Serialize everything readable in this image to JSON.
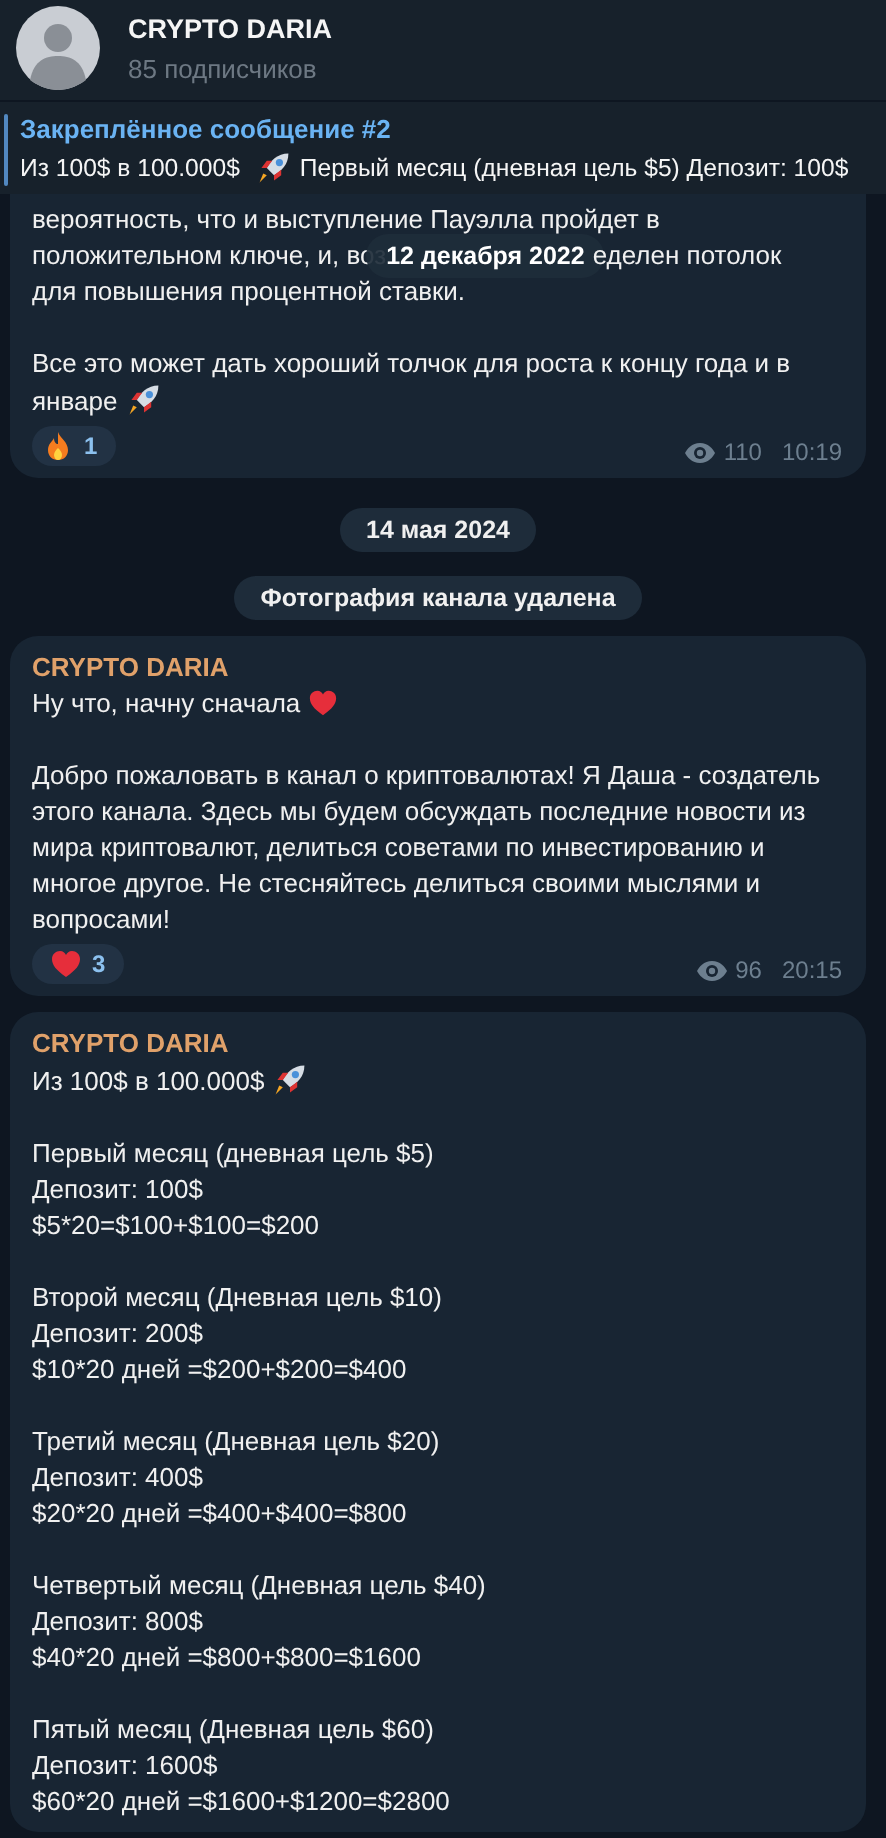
{
  "header": {
    "title": "CRYPTO DARIA",
    "subtitle": "85 подписчиков"
  },
  "pinned": {
    "title": "Закреплённое сообщение #2",
    "text_before": "Из 100$ в 100.000$",
    "text_after": "Первый месяц (дневная цель $5) Депозит: 100$"
  },
  "feed": [
    {
      "kind": "post",
      "blocks": [
        {
          "kind": "text",
          "text": "вероятность, что и выступление Пауэлла пройдет в"
        },
        {
          "kind": "date_overlap",
          "before": "положительном ключе, и, воз",
          "date": "12 декабря 2022",
          "after": "еделен потолок"
        },
        {
          "kind": "text",
          "text": "для повышения процентной ставки."
        },
        {
          "kind": "gap"
        },
        {
          "kind": "text_rocket",
          "text": "Все это может дать хороший толчок для роста к концу года и в январе"
        }
      ],
      "reactions": [
        {
          "kind": "fire",
          "count": "1"
        }
      ],
      "views": "110",
      "time": "10:19"
    },
    {
      "kind": "date",
      "text": "14 мая 2024"
    },
    {
      "kind": "service",
      "text": "Фотография канала удалена"
    },
    {
      "kind": "post",
      "author": "CRYPTO DARIA",
      "blocks": [
        {
          "kind": "text_heart",
          "text": "Ну что, начну сначала"
        },
        {
          "kind": "gap"
        },
        {
          "kind": "text",
          "text": "Добро пожаловать в канал о криптовалютах! Я Даша - создатель этого канала. Здесь мы будем обсуждать последние новости из мира криптовалют, делиться советами по инвестированию и многое другое. Не стесняйтесь делиться своими мыслями и вопросами!"
        }
      ],
      "reactions": [
        {
          "kind": "heart",
          "count": "3"
        }
      ],
      "views": "96",
      "time": "20:15"
    },
    {
      "kind": "post",
      "author": "CRYPTO DARIA",
      "blocks": [
        {
          "kind": "text_rocket",
          "text": "Из 100$ в 100.000$"
        },
        {
          "kind": "gap"
        },
        {
          "kind": "text",
          "text": "Первый месяц (дневная цель $5)"
        },
        {
          "kind": "text",
          "text": "Депозит: 100$"
        },
        {
          "kind": "text",
          "text": "$5*20=$100+$100=$200"
        },
        {
          "kind": "gap"
        },
        {
          "kind": "text",
          "text": "Второй месяц (Дневная цель $10)"
        },
        {
          "kind": "text",
          "text": "Депозит: 200$"
        },
        {
          "kind": "text",
          "text": "$10*20 дней =$200+$200=$400"
        },
        {
          "kind": "gap"
        },
        {
          "kind": "text",
          "text": "Третий месяц (Дневная цель $20)"
        },
        {
          "kind": "text",
          "text": "Депозит: 400$"
        },
        {
          "kind": "text",
          "text": "$20*20 дней =$400+$400=$800"
        },
        {
          "kind": "gap"
        },
        {
          "kind": "text",
          "text": "Четвертый месяц (Дневная цель $40)"
        },
        {
          "kind": "text",
          "text": "Депозит: 800$"
        },
        {
          "kind": "text",
          "text": "$40*20 дней =$800+$800=$1600"
        },
        {
          "kind": "gap"
        },
        {
          "kind": "text",
          "text": "Пятый месяц (Дневная цель $60)"
        },
        {
          "kind": "text",
          "text": "Депозит: 1600$"
        },
        {
          "kind": "text",
          "text": "$60*20 дней =$1600+$1200=$2800"
        }
      ]
    }
  ]
}
